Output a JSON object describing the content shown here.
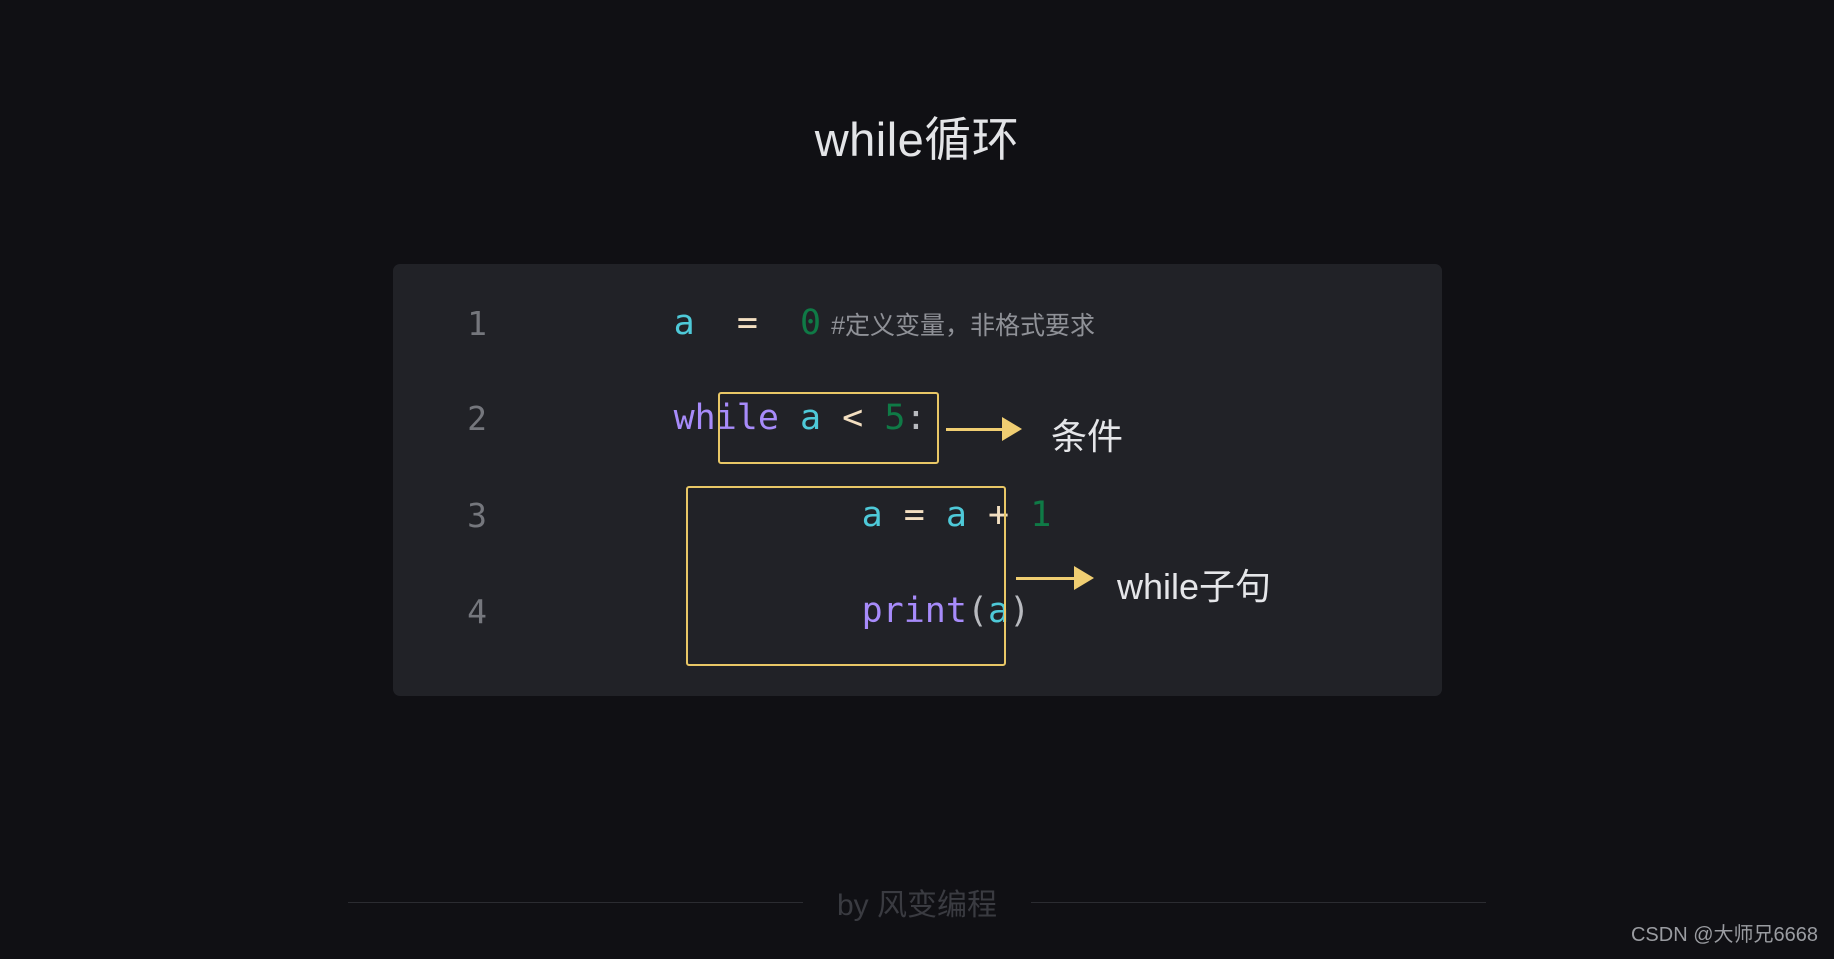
{
  "slide": {
    "title": "while循环",
    "background_color": "#101014"
  },
  "code_panel": {
    "background_color": "#212227",
    "language": "python",
    "lines": [
      {
        "number": "1",
        "text": "a = 0 #定义变量，非格式要求",
        "tokens": {
          "var": "a",
          "op": "=",
          "num": "0",
          "comment": "#定义变量，非格式要求"
        }
      },
      {
        "number": "2",
        "text": "while a < 5:",
        "tokens": {
          "keyword": "while",
          "var": "a",
          "op": "<",
          "num": "5",
          "punct": ":"
        }
      },
      {
        "number": "3",
        "text": "    a = a + 1",
        "tokens": {
          "var_left": "a",
          "op_assign": "=",
          "var_right": "a",
          "op_plus": "+",
          "num": "1"
        }
      },
      {
        "number": "4",
        "text": "    print(a)",
        "tokens": {
          "fn": "print",
          "paren_open": "(",
          "var": "a",
          "paren_close": ")"
        }
      }
    ]
  },
  "annotations": {
    "accent_color": "#e8c766",
    "items": [
      {
        "id": "condition",
        "label": "条件",
        "targets": "a < 5:"
      },
      {
        "id": "while-body",
        "label": "while子句",
        "targets": "a = a + 1 / print(a)"
      }
    ]
  },
  "footer": {
    "credit": "by 风变编程"
  },
  "watermark": {
    "text": "CSDN @大师兄6668"
  }
}
